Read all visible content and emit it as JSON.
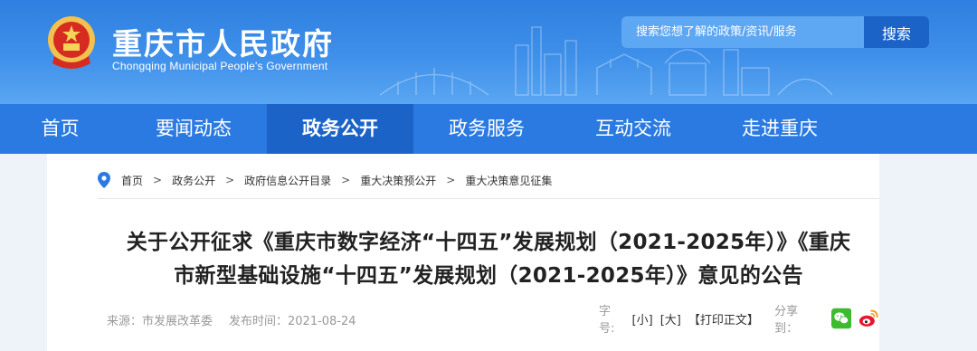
{
  "header": {
    "title": "重庆市人民政府",
    "subtitle": "Chongqing Municipal People's Government",
    "search_placeholder": "搜索您想了解的政策/资讯/服务",
    "search_button": "搜索"
  },
  "nav": {
    "items": [
      "首页",
      "要闻动态",
      "政务公开",
      "政务服务",
      "互动交流",
      "走进重庆"
    ],
    "active": "政务公开"
  },
  "breadcrumb": [
    "首页",
    "政务公开",
    "政府信息公开目录",
    "重大决策预公开",
    "重大决策意见征集"
  ],
  "breadcrumb_separator": ">",
  "article": {
    "title_line1": "关于公开征求《重庆市数字经济“十四五”发展规划（2021-2025年）》《重庆",
    "title_line2": "市新型基础设施“十四五”发展规划（2021-2025年）》意见的公告",
    "source": "来源：市发展改革委",
    "publish_time": "发布时间：2021-08-24"
  },
  "tools": {
    "font_size_label": "字号:",
    "small": "[小]",
    "large": "[大]",
    "print": "【打印正文】",
    "share_label": "分享到："
  },
  "icons": [
    "emblem-icon",
    "location-pin-icon",
    "wechat-icon",
    "weibo-icon"
  ],
  "colors": {
    "header_blue": "#2f7fe0",
    "nav_blue": "#2a7ae2",
    "nav_active": "#1c63c7",
    "wechat_green": "#3dbb2f",
    "weibo_red": "#e6162d"
  }
}
